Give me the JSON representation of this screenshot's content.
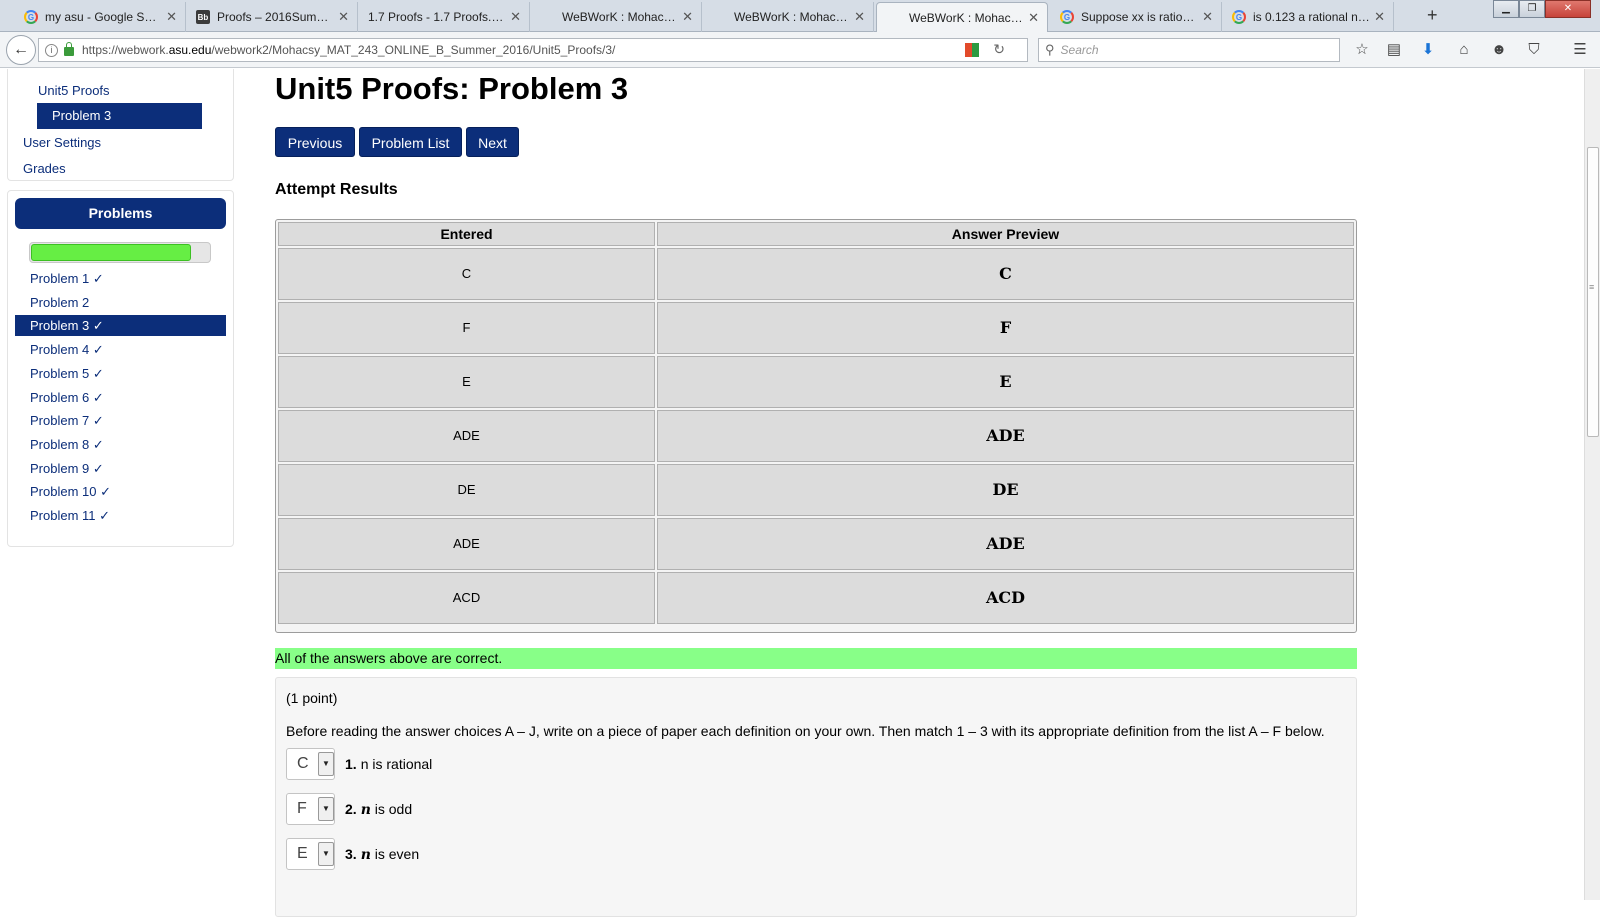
{
  "browser": {
    "tabs": [
      {
        "title": "my asu - Google Sea...",
        "favicon": "google",
        "active": false
      },
      {
        "title": "Proofs – 2016Summ...",
        "favicon": "blackboard",
        "active": false
      },
      {
        "title": "1.7 Proofs - 1.7 Proofs.pdf",
        "favicon": "none",
        "active": false
      },
      {
        "title": "WeBWorK : Mohacs...",
        "favicon": "none",
        "active": false
      },
      {
        "title": "WeBWorK : Mohacs...",
        "favicon": "none",
        "active": false
      },
      {
        "title": "WeBWorK : Mohacs...",
        "favicon": "none",
        "active": true
      },
      {
        "title": "Suppose xx is ration...",
        "favicon": "google",
        "active": false
      },
      {
        "title": "is 0.123 a rational nu...",
        "favicon": "google",
        "active": false
      }
    ],
    "url_prefix": "https://webwork.",
    "url_domain": "asu.edu",
    "url_path": "/webwork2/Mohacsy_MAT_243_ONLINE_B_Summer_2016/Unit5_Proofs/3/",
    "search_placeholder": "Search",
    "new_tab": "+"
  },
  "sidebar": {
    "unit_link": "Unit5 Proofs",
    "current_problem": "Problem 3",
    "user_settings": "User Settings",
    "grades": "Grades",
    "problems_header": "Problems",
    "progress_fraction": 0.9,
    "progress_color": "#66ee44",
    "problems": [
      {
        "label": "Problem 1 ✓",
        "current": false
      },
      {
        "label": "Problem 2",
        "current": false
      },
      {
        "label": "Problem 3 ✓",
        "current": true
      },
      {
        "label": "Problem 4 ✓",
        "current": false
      },
      {
        "label": "Problem 5 ✓",
        "current": false
      },
      {
        "label": "Problem 6 ✓",
        "current": false
      },
      {
        "label": "Problem 7 ✓",
        "current": false
      },
      {
        "label": "Problem 8 ✓",
        "current": false
      },
      {
        "label": "Problem 9 ✓",
        "current": false
      },
      {
        "label": "Problem 10 ✓",
        "current": false
      },
      {
        "label": "Problem 11 ✓",
        "current": false
      }
    ]
  },
  "main": {
    "title": "Unit5 Proofs: Problem 3",
    "buttons": {
      "previous": "Previous",
      "problem_list": "Problem List",
      "next": "Next"
    },
    "attempt_heading": "Attempt Results",
    "table": {
      "headers": [
        "Entered",
        "Answer Preview"
      ],
      "rows": [
        [
          "C",
          "C"
        ],
        [
          "F",
          "F"
        ],
        [
          "E",
          "E"
        ],
        [
          "ADE",
          "ADE"
        ],
        [
          "DE",
          "DE"
        ],
        [
          "ADE",
          "ADE"
        ],
        [
          "ACD",
          "ACD"
        ]
      ]
    },
    "correct_message": "All of the answers above are correct.",
    "points": "(1 point)",
    "instructions": "Before reading the answer choices A – J, write on a piece of paper each definition on your own. Then match 1 – 3 with its appropriate definition from the list A – F below.",
    "matches": [
      {
        "selected": "C",
        "number": "1.",
        "var": "n",
        "text": " is rational",
        "var_math": false
      },
      {
        "selected": "F",
        "number": "2.",
        "var": "n",
        "text": " is odd",
        "var_math": true
      },
      {
        "selected": "E",
        "number": "3.",
        "var": "n",
        "text": " is even",
        "var_math": true
      }
    ]
  },
  "colors": {
    "brand_navy": "#0c2e7a",
    "correct_green": "#88ff88"
  }
}
